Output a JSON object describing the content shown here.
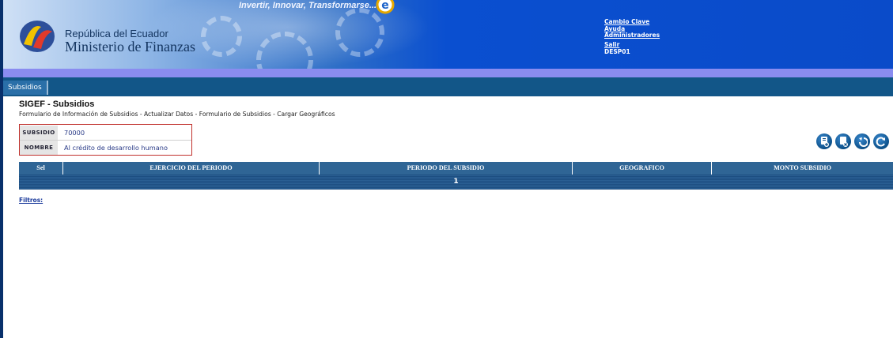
{
  "header": {
    "republic": "República del Ecuador",
    "ministry": "Ministerio de Finanzas",
    "slogan": "Invertir, Innovar, Transformarse...",
    "links": [
      "Cambio Clave",
      "Ayuda",
      "Administradores"
    ],
    "logout": "Salir",
    "user": "DESP01"
  },
  "nav": {
    "tab": "Subsidios"
  },
  "page": {
    "title": "SIGEF - Subsidios",
    "breadcrumb": "Formulario de Información de Subsidios - Actualizar Datos - Formulario de Subsidios - Cargar Geográficos"
  },
  "info": {
    "subsidio_label": "SUBSIDIO",
    "subsidio_value": "70000",
    "nombre_label": "NOMBRE",
    "nombre_value": "Al crédito de desarrollo humano"
  },
  "actions": [
    "add-icon",
    "delete-icon",
    "back-icon",
    "refresh-icon"
  ],
  "table": {
    "columns": [
      "Sel",
      "EJERCICIO DEL PERIODO",
      "PERIODO DEL SUBSIDIO",
      "GEOGRAFICO",
      "MONTO SUBSIDIO"
    ],
    "page": "1"
  },
  "filters_label": "Filtros:",
  "colors": {
    "header_blue": "#0a4bc9",
    "nav_blue": "#125688",
    "table_blue": "#2f6595",
    "purple_strip": "#8a8cf0"
  }
}
